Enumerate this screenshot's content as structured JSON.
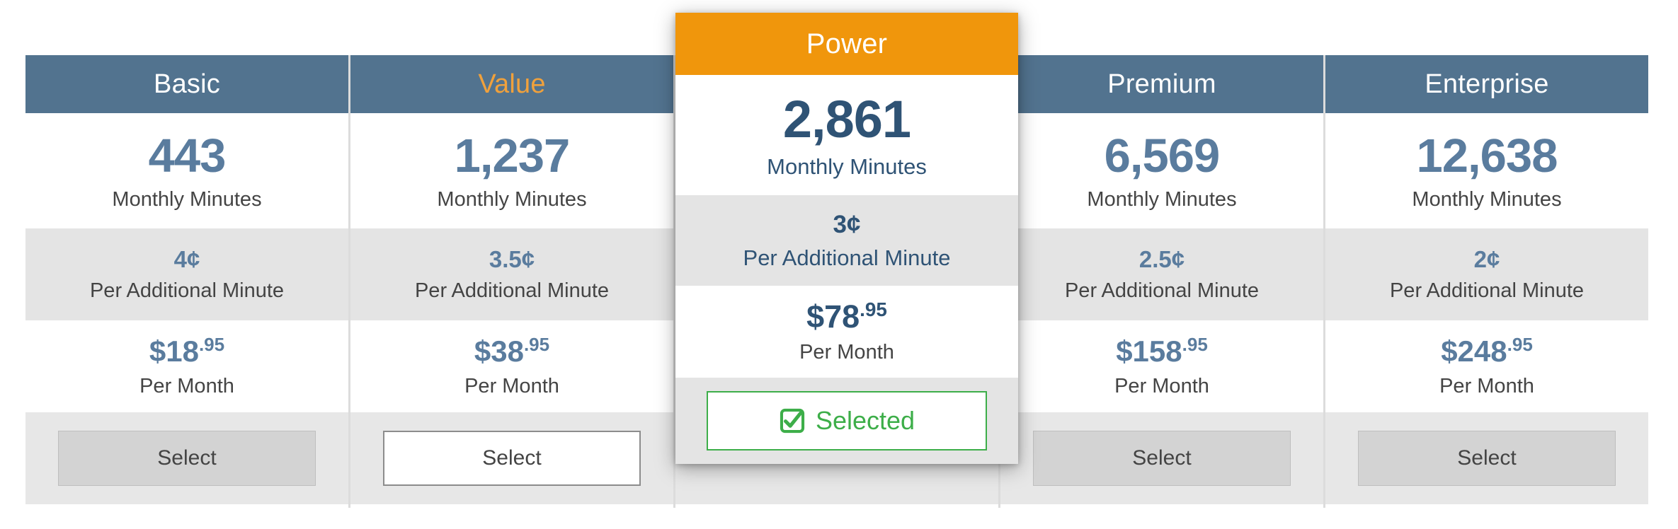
{
  "theme": {
    "header_bg": "#52738F",
    "featured_header_bg": "#F0960C",
    "hover_accent": "#F0A13C",
    "number_blue": "#5A7C9E",
    "featured_number_blue": "#2F5375",
    "alt_row_bg": "#E4E4E4",
    "selected_green": "#3DAE49",
    "button_bg": "#D3D3D3"
  },
  "labels": {
    "monthly_minutes": "Monthly Minutes",
    "per_additional_minute": "Per Additional Minute",
    "per_month": "Per Month",
    "select": "Select",
    "selected": "Selected",
    "check_icon": "checkbox-checked-icon"
  },
  "plans": [
    {
      "id": "basic",
      "name": "Basic",
      "minutes": "443",
      "rate": "4¢",
      "price_dollars": "$18",
      "price_cents": ".95",
      "action_label": "Select",
      "state": "default"
    },
    {
      "id": "value",
      "name": "Value",
      "minutes": "1,237",
      "rate": "3.5¢",
      "price_dollars": "$38",
      "price_cents": ".95",
      "action_label": "Select",
      "state": "hovered"
    },
    {
      "id": "power",
      "name": "Power",
      "minutes": "2,861",
      "rate": "3¢",
      "price_dollars": "$78",
      "price_cents": ".95",
      "action_label": "Selected",
      "state": "selected"
    },
    {
      "id": "premium",
      "name": "Premium",
      "minutes": "6,569",
      "rate": "2.5¢",
      "price_dollars": "$158",
      "price_cents": ".95",
      "action_label": "Select",
      "state": "default"
    },
    {
      "id": "enterprise",
      "name": "Enterprise",
      "minutes": "12,638",
      "rate": "2¢",
      "price_dollars": "$248",
      "price_cents": ".95",
      "action_label": "Select",
      "state": "default"
    }
  ]
}
